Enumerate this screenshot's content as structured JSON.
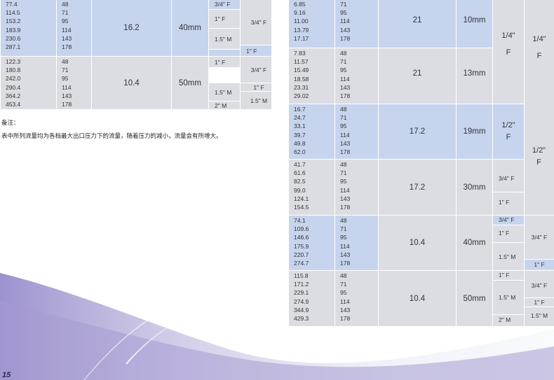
{
  "notes": {
    "label": "备注：",
    "text": "表中所列流量均为各档最大出口压力下的流量，随着压力的减小，流量会有所增大。"
  },
  "page_number": "15",
  "left_table": {
    "group_a": {
      "flow_values": [
        "77.4",
        "114.5",
        "153.2",
        "183.9",
        "230.6",
        "287.1"
      ],
      "pressure_values": [
        "48",
        "71",
        "95",
        "114",
        "143",
        "178"
      ],
      "bore": "16.2",
      "stroke": "40mm",
      "inlets": [
        "3/4\" F",
        "1\" F",
        "1.5\" M"
      ],
      "outlets": [
        "3/4\" F",
        "1\" F"
      ]
    },
    "group_b": {
      "flow_values": [
        "122.3",
        "180.8",
        "242.0",
        "290.4",
        "364.2",
        "453.4"
      ],
      "pressure_values": [
        "48",
        "71",
        "95",
        "114",
        "143",
        "178"
      ],
      "bore": "10.4",
      "stroke": "50mm",
      "inlets": [
        "1\" F",
        "1.5\" M",
        "2\" M"
      ],
      "outlets": [
        "3/4\" F",
        "1\" F",
        "1.5\" M"
      ]
    }
  },
  "right_table": {
    "groups": [
      {
        "flow_values": [
          "6.85",
          "9.16",
          "11.00",
          "13.79",
          "17.17"
        ],
        "pressure_values": [
          "71",
          "95",
          "114",
          "143",
          "178"
        ],
        "bore": "21",
        "stroke": "10mm"
      },
      {
        "flow_values": [
          "7.83",
          "11.57",
          "15.49",
          "18.58",
          "23.31",
          "29.02"
        ],
        "pressure_values": [
          "48",
          "71",
          "95",
          "114",
          "143",
          "178"
        ],
        "bore": "21",
        "stroke": "13mm"
      },
      {
        "flow_values": [
          "16.7",
          "24.7",
          "33.1",
          "39.7",
          "49.8",
          "62.0"
        ],
        "pressure_values": [
          "48",
          "71",
          "95",
          "114",
          "143",
          "178"
        ],
        "bore": "17.2",
        "stroke": "19mm"
      },
      {
        "flow_values": [
          "41.7",
          "61.6",
          "82.5",
          "99.0",
          "124.1",
          "154.5"
        ],
        "pressure_values": [
          "48",
          "71",
          "95",
          "114",
          "143",
          "178"
        ],
        "bore": "17.2",
        "stroke": "30mm"
      },
      {
        "flow_values": [
          "74.1",
          "109.6",
          "146.6",
          "175.9",
          "220.7",
          "274.7"
        ],
        "pressure_values": [
          "48",
          "71",
          "95",
          "114",
          "143",
          "178"
        ],
        "bore": "10.4",
        "stroke": "40mm"
      },
      {
        "flow_values": [
          "115.8",
          "171.2",
          "229.1",
          "274.9",
          "344.9",
          "429.3"
        ],
        "pressure_values": [
          "48",
          "71",
          "95",
          "114",
          "143",
          "178"
        ],
        "bore": "10.4",
        "stroke": "50mm"
      }
    ],
    "inlet_quarter": "1/4\"",
    "inlet_quarter_f": "F",
    "outlet_quarter": "1/4\"",
    "outlet_quarter_f": "F",
    "inlet_half": "1/2\"",
    "inlet_half_f": "F",
    "outlet_half": "1/2\"",
    "outlet_half_f": "F",
    "g4_inlets": [
      "3/4\" F",
      "1\" F"
    ],
    "g5_inlets": [
      "3/4\" F",
      "1\" F",
      "1.5\" M"
    ],
    "g5_outlets": [
      "3/4\" F",
      "1\" F"
    ],
    "g6_inlets": [
      "1\" F",
      "1.5\" M",
      "2\" M"
    ],
    "g6_outlets": [
      "3/4\" F",
      "1\" F",
      "1.5\" M"
    ]
  }
}
